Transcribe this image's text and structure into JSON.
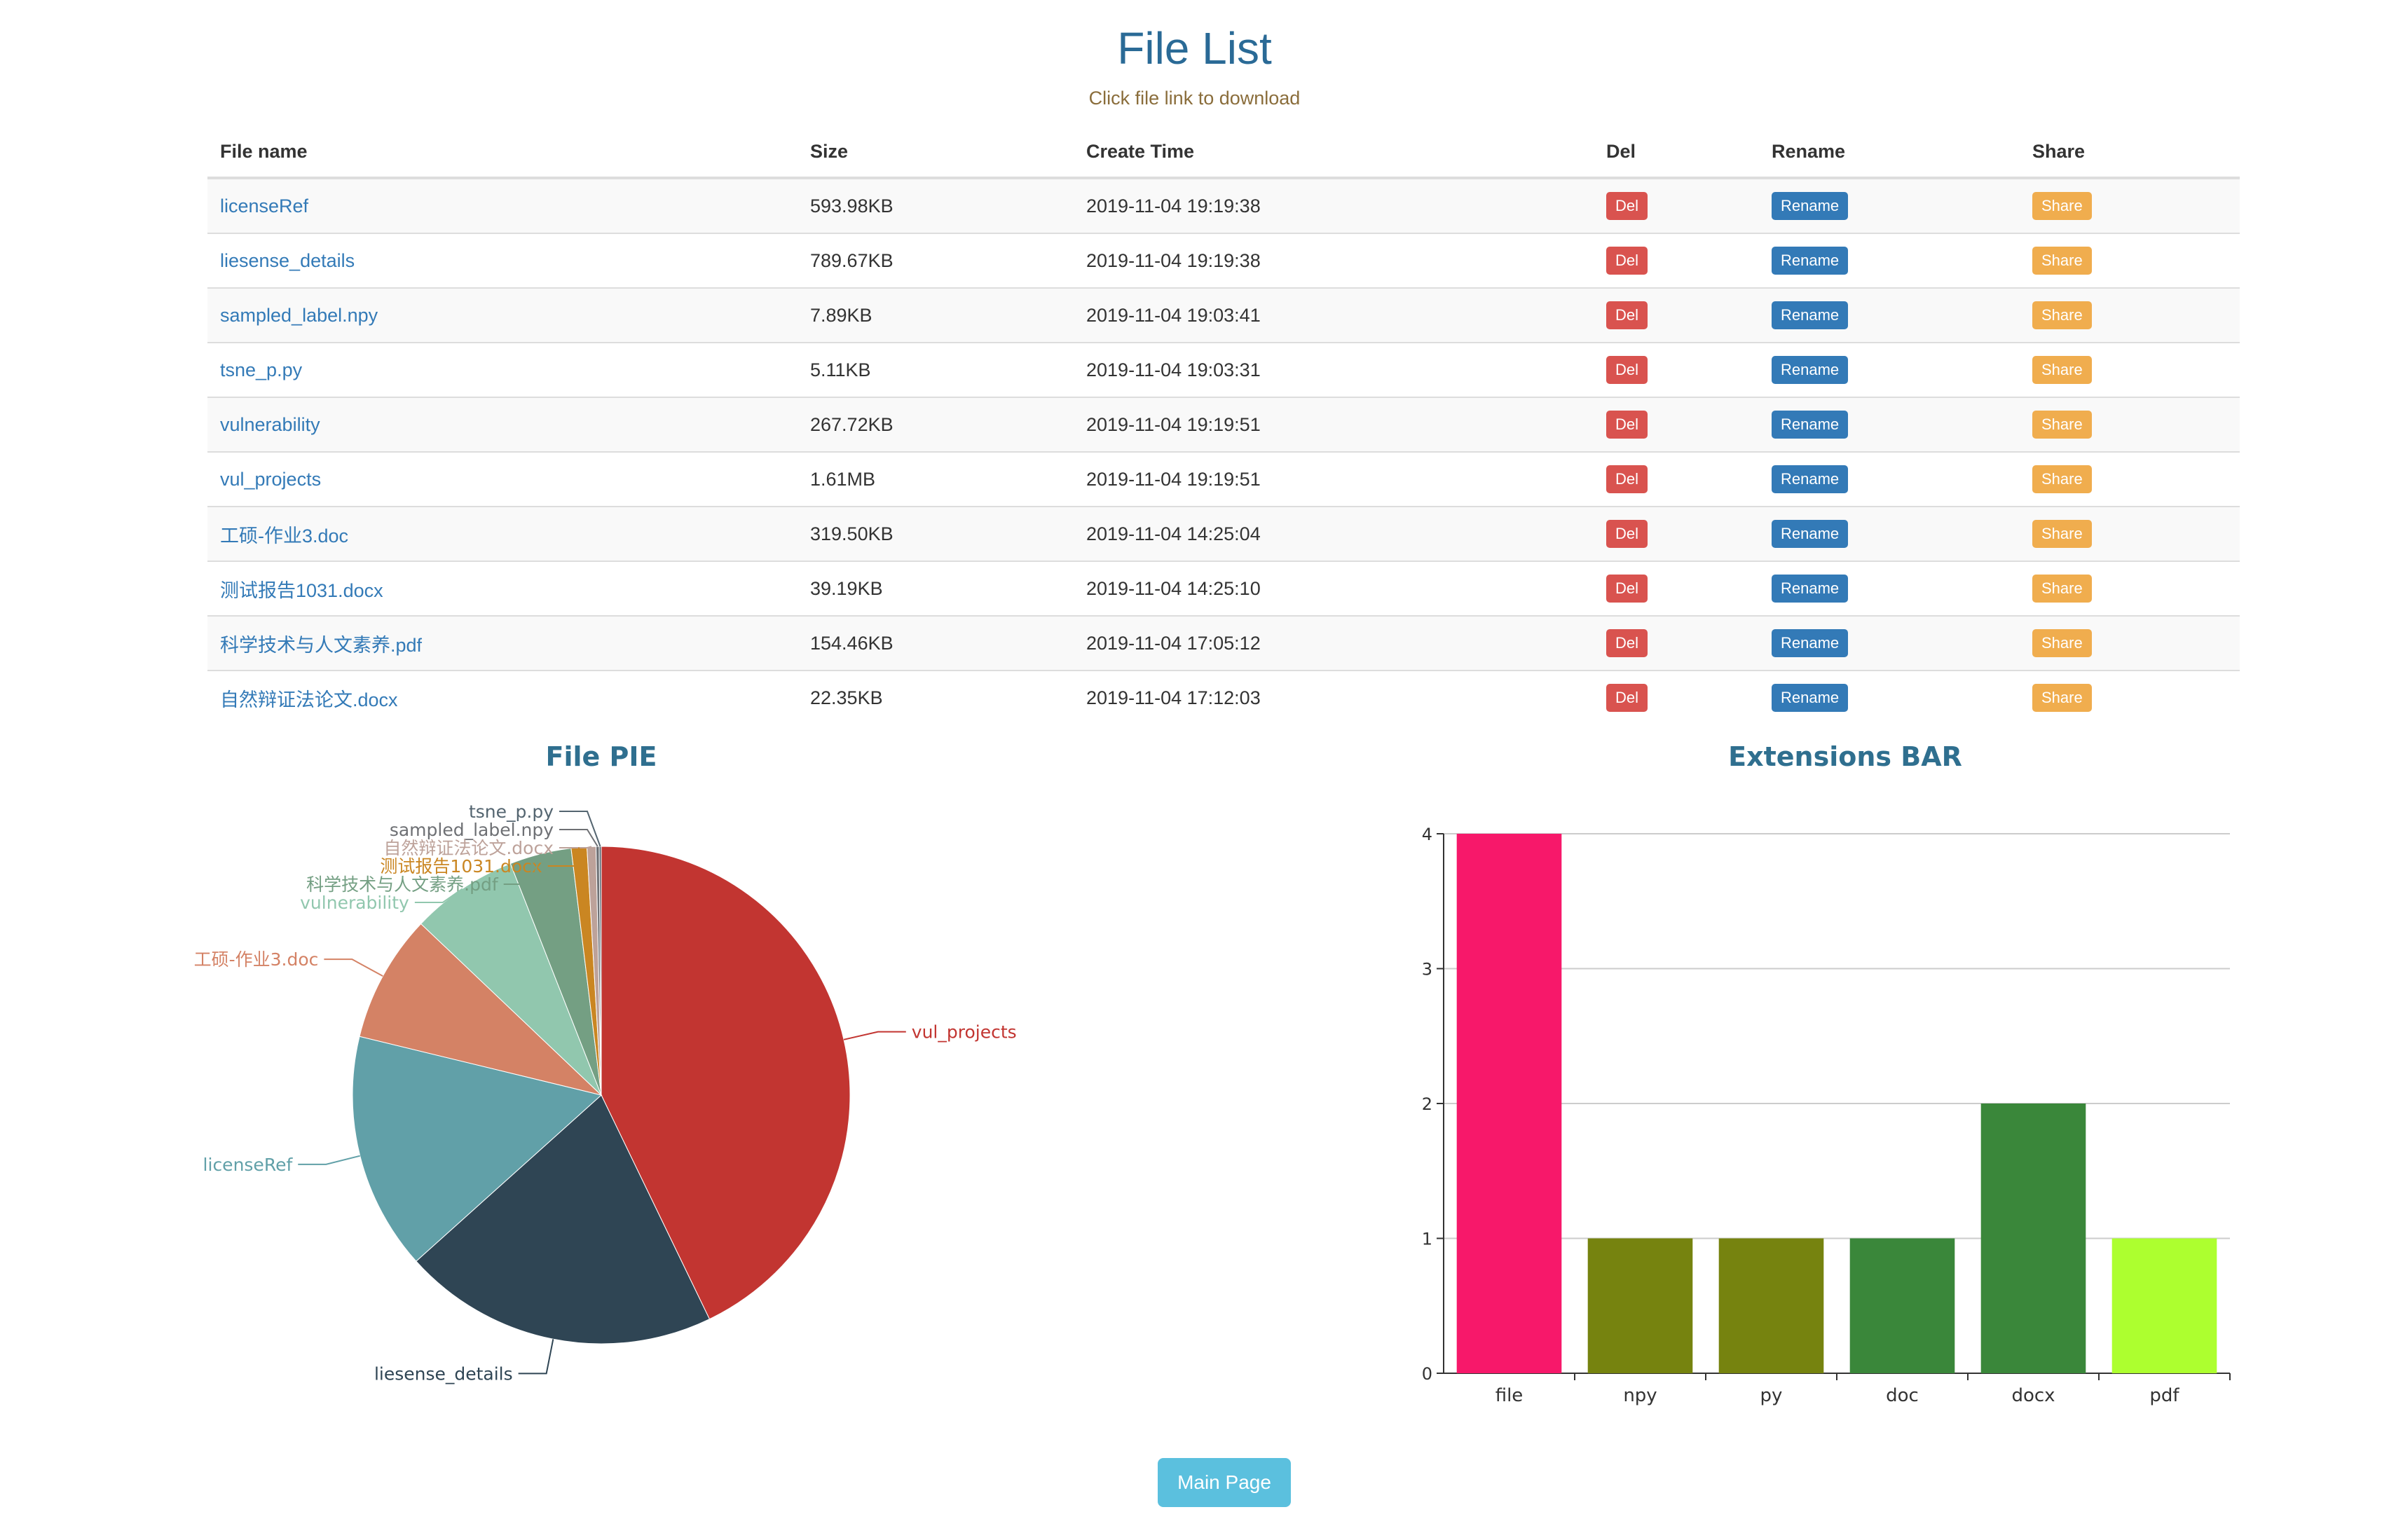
{
  "header": {
    "title": "File List",
    "subtitle": "Click file link to download"
  },
  "table": {
    "columns": [
      "File name",
      "Size",
      "Create Time",
      "Del",
      "Rename",
      "Share"
    ],
    "rows": [
      {
        "name": "licenseRef",
        "size": "593.98KB",
        "time": "2019-11-04 19:19:38",
        "del": "Del",
        "rename": "Rename",
        "share": "Share"
      },
      {
        "name": "liesense_details",
        "size": "789.67KB",
        "time": "2019-11-04 19:19:38",
        "del": "Del",
        "rename": "Rename",
        "share": "Share"
      },
      {
        "name": "sampled_label.npy",
        "size": "7.89KB",
        "time": "2019-11-04 19:03:41",
        "del": "Del",
        "rename": "Rename",
        "share": "Share"
      },
      {
        "name": "tsne_p.py",
        "size": "5.11KB",
        "time": "2019-11-04 19:03:31",
        "del": "Del",
        "rename": "Rename",
        "share": "Share"
      },
      {
        "name": "vulnerability",
        "size": "267.72KB",
        "time": "2019-11-04 19:19:51",
        "del": "Del",
        "rename": "Rename",
        "share": "Share"
      },
      {
        "name": "vul_projects",
        "size": "1.61MB",
        "time": "2019-11-04 19:19:51",
        "del": "Del",
        "rename": "Rename",
        "share": "Share"
      },
      {
        "name": "工硕-作业3.doc",
        "size": "319.50KB",
        "time": "2019-11-04 14:25:04",
        "del": "Del",
        "rename": "Rename",
        "share": "Share"
      },
      {
        "name": "测试报告1031.docx",
        "size": "39.19KB",
        "time": "2019-11-04 14:25:10",
        "del": "Del",
        "rename": "Rename",
        "share": "Share"
      },
      {
        "name": "科学技术与人文素养.pdf",
        "size": "154.46KB",
        "time": "2019-11-04 17:05:12",
        "del": "Del",
        "rename": "Rename",
        "share": "Share"
      },
      {
        "name": "自然辩证法论文.docx",
        "size": "22.35KB",
        "time": "2019-11-04 17:12:03",
        "del": "Del",
        "rename": "Rename",
        "share": "Share"
      }
    ]
  },
  "chart_data": [
    {
      "type": "pie",
      "title": "File PIE",
      "slices": [
        {
          "label": "vul_projects",
          "value": 1648.64,
          "color": "#c23531"
        },
        {
          "label": "liesense_details",
          "value": 789.67,
          "color": "#2f4554"
        },
        {
          "label": "licenseRef",
          "value": 593.98,
          "color": "#61a0a8"
        },
        {
          "label": "工硕-作业3.doc",
          "value": 319.5,
          "color": "#d48265"
        },
        {
          "label": "vulnerability",
          "value": 267.72,
          "color": "#91c7ae"
        },
        {
          "label": "科学技术与人文素养.pdf",
          "value": 154.46,
          "color": "#749f83"
        },
        {
          "label": "测试报告1031.docx",
          "value": 39.19,
          "color": "#ca8622"
        },
        {
          "label": "自然辩证法论文.docx",
          "value": 22.35,
          "color": "#bda29a"
        },
        {
          "label": "sampled_label.npy",
          "value": 7.89,
          "color": "#6e7074"
        },
        {
          "label": "tsne_p.py",
          "value": 5.11,
          "color": "#546570"
        }
      ]
    },
    {
      "type": "bar",
      "title": "Extensions BAR",
      "categories": [
        "file",
        "npy",
        "py",
        "doc",
        "docx",
        "pdf"
      ],
      "values": [
        4,
        1,
        1,
        1,
        2,
        1
      ],
      "colors": [
        "#f7186a",
        "#76830f",
        "#76830f",
        "#3a873a",
        "#3a873a",
        "#adff2f"
      ],
      "ylim": [
        0,
        4
      ],
      "yticks": [
        "0",
        "1",
        "2",
        "3",
        "4"
      ],
      "grid": true
    }
  ],
  "footer": {
    "main_page_label": "Main Page"
  }
}
